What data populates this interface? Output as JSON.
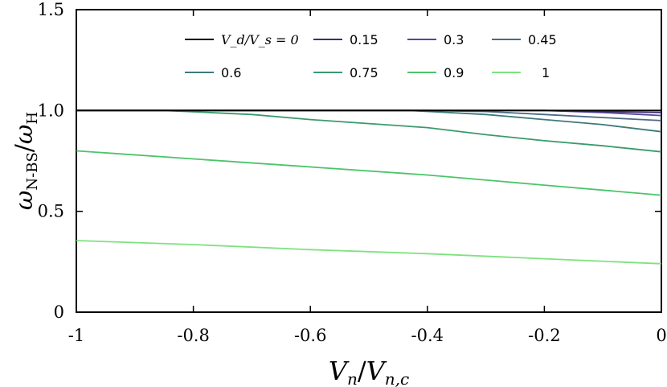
{
  "chart_data": {
    "type": "line",
    "title": "",
    "xlabel": "V_n/V_n,c",
    "ylabel": "ω_N-BS/ω_H",
    "xlim": [
      -1,
      0
    ],
    "ylim": [
      0,
      1.5
    ],
    "x_ticks": [
      "-1",
      "-0.8",
      "-0.6",
      "-0.4",
      "-0.2",
      "0"
    ],
    "y_ticks": [
      "0",
      "0.5",
      "1.0",
      "1.5"
    ],
    "grid": false,
    "legend_position": "top-inside",
    "series": [
      {
        "name": "V_d/V_s = 0",
        "color": "#000004",
        "x": [
          -1,
          -0.8,
          -0.6,
          -0.4,
          -0.2,
          0
        ],
        "y": [
          1.0,
          1.0,
          1.0,
          1.0,
          1.0,
          1.0
        ]
      },
      {
        "name": "0.15",
        "color": "#3b2f6b",
        "x": [
          -1,
          -0.8,
          -0.6,
          -0.4,
          -0.2,
          -0.1,
          0
        ],
        "y": [
          1.0,
          1.0,
          1.0,
          1.0,
          1.0,
          0.995,
          0.99
        ]
      },
      {
        "name": "0.3",
        "color": "#56449e",
        "x": [
          -1,
          -0.8,
          -0.6,
          -0.4,
          -0.2,
          -0.1,
          0
        ],
        "y": [
          1.0,
          1.0,
          1.0,
          1.0,
          1.0,
          0.99,
          0.975
        ]
      },
      {
        "name": "0.45",
        "color": "#4a6a86",
        "x": [
          -1,
          -0.8,
          -0.6,
          -0.4,
          -0.3,
          -0.2,
          -0.1,
          0
        ],
        "y": [
          1.0,
          1.0,
          1.0,
          1.0,
          0.995,
          0.98,
          0.965,
          0.95
        ]
      },
      {
        "name": "0.6",
        "color": "#3e7a7a",
        "x": [
          -1,
          -0.6,
          -0.43,
          -0.3,
          -0.2,
          -0.1,
          0
        ],
        "y": [
          1.0,
          1.0,
          1.0,
          0.98,
          0.955,
          0.93,
          0.895
        ]
      },
      {
        "name": "0.75",
        "color": "#3a9a6e",
        "x": [
          -1,
          -0.85,
          -0.7,
          -0.6,
          -0.5,
          -0.4,
          -0.3,
          -0.2,
          -0.1,
          0
        ],
        "y": [
          1.0,
          1.0,
          0.98,
          0.955,
          0.935,
          0.915,
          0.88,
          0.85,
          0.825,
          0.795
        ]
      },
      {
        "name": "0.9",
        "color": "#4cc46a",
        "x": [
          -1,
          -0.8,
          -0.6,
          -0.4,
          -0.2,
          0
        ],
        "y": [
          0.8,
          0.76,
          0.72,
          0.68,
          0.63,
          0.58
        ]
      },
      {
        "name": "1",
        "color": "#7ee27e",
        "x": [
          -1,
          -0.8,
          -0.6,
          -0.4,
          -0.2,
          0
        ],
        "y": [
          0.355,
          0.335,
          0.31,
          0.29,
          0.265,
          0.24
        ]
      }
    ]
  }
}
